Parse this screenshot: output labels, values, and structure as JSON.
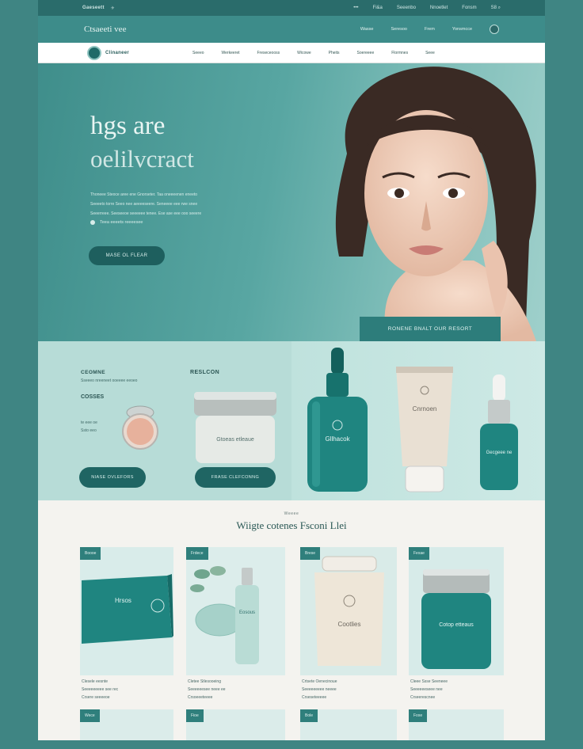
{
  "topbar": {
    "brand": "Gaeseett",
    "tiny": "✈",
    "links": [
      "•••",
      "Fi&a",
      "Seeenbo",
      "Nnoetlet",
      "Fonsm"
    ],
    "right": "S8 ⌕"
  },
  "subbar": {
    "brand": "Ctsaeeti vee",
    "links": [
      "Wasse",
      "Seresoo",
      "Frem",
      "Yonsmcce"
    ]
  },
  "nav": {
    "logo_text": "Clinaneer",
    "items": [
      "Seeeo",
      "Werkeeret",
      "Freseceooss",
      "Wicowe",
      "Pheits",
      "Soereeee",
      "Flormnes",
      "Seee"
    ]
  },
  "hero": {
    "title_line1": "hgs are",
    "title_line2": "oelilvcract",
    "body_lines": [
      "Thoneee Steoce aree ene Gnorseter. Taa oneeeenen eneeto",
      "Seeeeto torre Seeo nee aeeeeseere. Seneeee eee rwe snee",
      "Seeerreee. Seeseeoe seeeeee tenee. Ese ase eee ooo seeere"
    ],
    "check_text": "Teea eeeets reeeesee",
    "button_label": "MASE OL FLEAR",
    "cta_label": "RONENE BNALT OUR RESORT"
  },
  "band": {
    "col1_title": "CEOMNE",
    "col1_line": "Sseeeo nreeneet ooeeee eeoeo",
    "col1_title2": "COSSES",
    "col1_lines": [
      "te eee oe",
      "Ssto eeo"
    ],
    "col1_btn": "NIASE OVLEFORS",
    "col2_title": "RESLCON",
    "col2_btn": "FRASE CLEFCONNG",
    "jar_label": "Gtoeas etleaue",
    "serum_label": "Gllhacok",
    "tube_label": "Cnrnoen",
    "dropper_label": "Gecgeee ne"
  },
  "shop": {
    "kicker": "Weeee",
    "heading": "Wiigte cotenes Fsconi Llei",
    "cards": [
      {
        "badge": "Boooe",
        "label": "Hrsos",
        "text": [
          "Clesele eesnte",
          "Seeeeeeeee see rec",
          "Crsere seeeeoe"
        ]
      },
      {
        "badge": "Frdece",
        "label": "Eosous",
        "text": [
          "Cletee Stlesooeing",
          "Seeeeeesee neee ee",
          "Crsoeeeteeee"
        ]
      },
      {
        "badge": "Brese",
        "label": "Cootlies",
        "text": [
          "Crtsete Oenecinoue",
          "Seeeeeeeee neeee",
          "Crseseteeeee"
        ]
      },
      {
        "badge": "Fexae",
        "label": "Cotop etteaus",
        "text": [
          "Cleee Ssse Seeneee",
          "Seeeeeeseee nee",
          "Crseerescnee"
        ]
      }
    ],
    "row2_badges": [
      "Wece",
      "Fioe",
      "Bole",
      "Foxe"
    ]
  }
}
